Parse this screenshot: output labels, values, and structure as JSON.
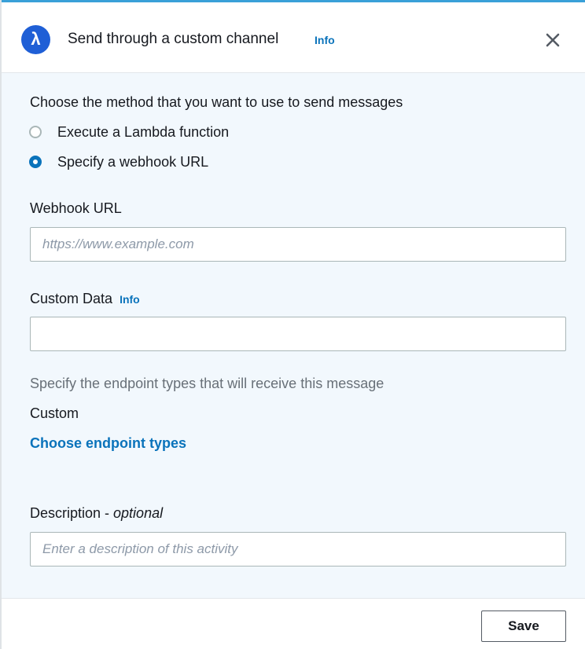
{
  "colors": {
    "accent": "#0a73bb",
    "badge": "#1f5fd6",
    "panel_background": "#f2f8fd"
  },
  "header": {
    "icon": "lambda-icon",
    "badge_glyph": "λ",
    "title": "Send through a custom channel",
    "info_label": "Info",
    "close_icon": "close-icon"
  },
  "method": {
    "prompt": "Choose the method that you want to use to send messages",
    "options": [
      {
        "label": "Execute a Lambda function",
        "selected": false
      },
      {
        "label": "Specify a webhook URL",
        "selected": true
      }
    ]
  },
  "webhook": {
    "label": "Webhook URL",
    "value": "",
    "placeholder": "https://www.example.com"
  },
  "custom_data": {
    "label": "Custom Data",
    "info_label": "Info",
    "value": "",
    "placeholder": ""
  },
  "endpoints": {
    "hint": "Specify the endpoint types that will receive this message",
    "current": "Custom",
    "link_label": "Choose endpoint types"
  },
  "description": {
    "label": "Description - ",
    "label_optional": "optional",
    "value": "",
    "placeholder": "Enter a description of this activity"
  },
  "footer": {
    "save_label": "Save"
  }
}
